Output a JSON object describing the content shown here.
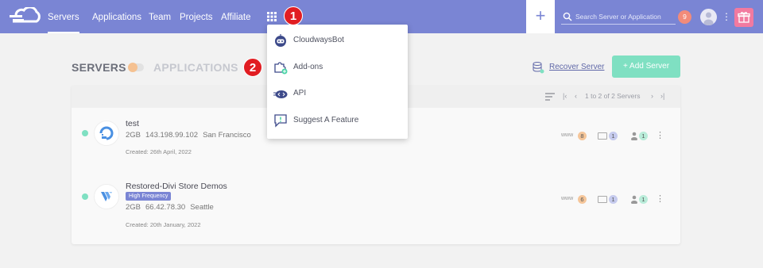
{
  "nav": {
    "items": [
      {
        "label": "Servers",
        "active": true
      },
      {
        "label": "Applications",
        "active": false
      },
      {
        "label": "Team",
        "active": false
      },
      {
        "label": "Projects",
        "active": false
      },
      {
        "label": "Affiliate",
        "active": false
      }
    ],
    "plus_label": "+",
    "search_placeholder": "Search Server or Application",
    "notification_count": "9",
    "colors": {
      "bar": "#7a85d4",
      "gift": "#f27aa0",
      "notif": "#f28b7a"
    }
  },
  "callouts": [
    "1",
    "2"
  ],
  "dropdown": {
    "items": [
      {
        "label": "CloudwaysBot",
        "icon": "robot-icon"
      },
      {
        "label": "Add-ons",
        "icon": "puzzle-icon"
      },
      {
        "label": "API",
        "icon": "api-icon"
      },
      {
        "label": "Suggest A Feature",
        "icon": "suggest-feature-icon"
      }
    ]
  },
  "header": {
    "servers_tab": "SERVERS",
    "applications_tab": "APPLICATIONS",
    "recover_label": "Recover Server",
    "add_server_label": "+ Add Server",
    "add_server_color": "#7fe0c2"
  },
  "pager": {
    "text": "1 to 2 of 2 Servers"
  },
  "servers": [
    {
      "name": "test",
      "badge": "",
      "size": "2GB",
      "ip": "143.198.99.102",
      "location": "San Francisco",
      "created": "Created: 26th April, 2022",
      "provider_icon": "digitalocean-icon",
      "www_label": "www",
      "apps": "8",
      "files": "1",
      "users": "1"
    },
    {
      "name": "Restored-Divi Store Demos",
      "badge": "High Frequency",
      "size": "2GB",
      "ip": "66.42.78.30",
      "location": "Seattle",
      "created": "Created: 20th January, 2022",
      "provider_icon": "vultr-icon",
      "www_label": "www",
      "apps": "6",
      "files": "1",
      "users": "1"
    }
  ]
}
